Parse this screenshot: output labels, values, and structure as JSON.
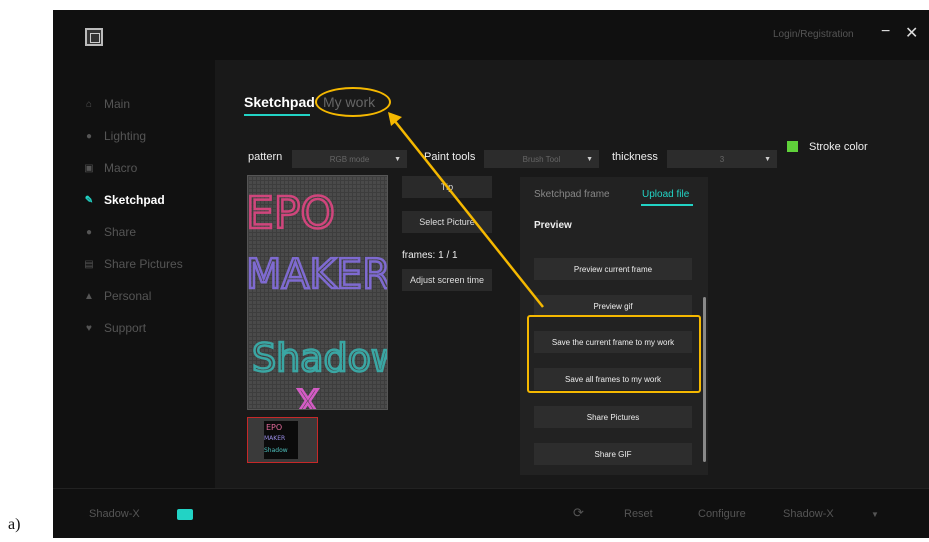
{
  "figure_label": "a)",
  "titlebar": {
    "login": "Login/Registration",
    "minimize": "−",
    "close": "✕"
  },
  "sidebar": {
    "items": [
      {
        "label": "Main",
        "icon": "home-icon",
        "glyph": "⌂"
      },
      {
        "label": "Lighting",
        "icon": "bulb-icon",
        "glyph": "●"
      },
      {
        "label": "Macro",
        "icon": "macro-icon",
        "glyph": "▣"
      },
      {
        "label": "Sketchpad",
        "icon": "sketchpad-icon",
        "glyph": "✎"
      },
      {
        "label": "Share",
        "icon": "share-icon",
        "glyph": "●"
      },
      {
        "label": "Share Pictures",
        "icon": "picture-icon",
        "glyph": "▤"
      },
      {
        "label": "Personal",
        "icon": "person-icon",
        "glyph": "▲"
      },
      {
        "label": "Support",
        "icon": "support-icon",
        "glyph": "♥"
      }
    ],
    "active_index": 3
  },
  "tabs": {
    "sketchpad": "Sketchpad",
    "mywork": "My work"
  },
  "controls": {
    "pattern_label": "pattern",
    "pattern_value": "RGB mode",
    "paint_label": "Paint tools",
    "paint_value": "Brush Tool",
    "thickness_label": "thickness",
    "thickness_value": "3",
    "stroke_label": "Stroke color",
    "stroke_color": "#5fd13a"
  },
  "canvas_text": {
    "line1": "EPO",
    "line2": "MAKER",
    "line3": "Shadow",
    "line4": "X"
  },
  "buttons": {
    "tip": "Tip",
    "select_picture": "Select Picture",
    "frames": "frames: 1 / 1",
    "adjust_time": "Adjust screen time"
  },
  "panel": {
    "tab_frame": "Sketchpad frame",
    "tab_upload": "Upload file",
    "preview": "Preview",
    "buttons": [
      "Preview current frame",
      "Preview gif",
      "Save the current frame to my work",
      "Save all frames to my work",
      "Share Pictures",
      "Share GIF"
    ]
  },
  "footer": {
    "device": "Shadow-X",
    "reset": "Reset",
    "configure": "Configure",
    "device_select": "Shadow-X"
  },
  "colors": {
    "accent": "#22d3c5",
    "highlight": "#f5b800"
  }
}
